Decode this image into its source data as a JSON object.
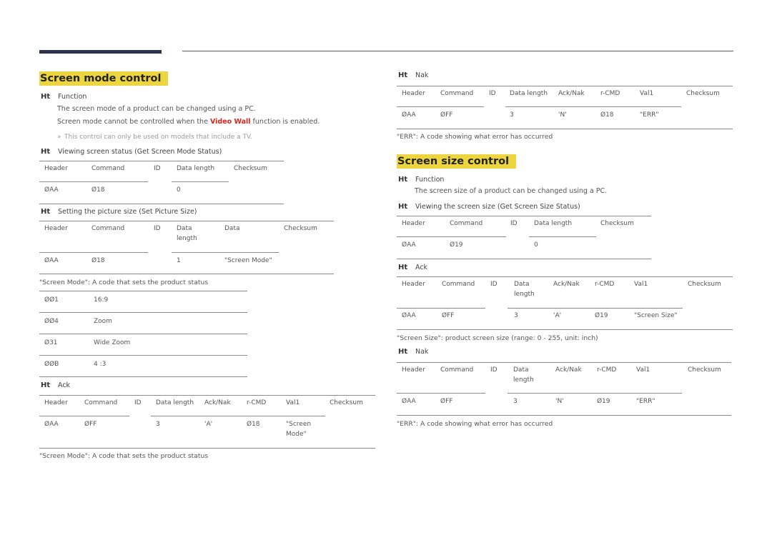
{
  "left": {
    "title": "Screen mode control",
    "function_label": "Function",
    "bullet_marker": "Ht",
    "desc1": "The screen mode of a product can be changed using a PC.",
    "desc2_pre": "Screen mode cannot be controlled when the ",
    "desc2_highlight": "Video Wall",
    "desc2_post": " function is enabled.",
    "note_marker": "»",
    "note": "This control can only be used on models that include a TV.",
    "view_status_label": "Viewing screen status (Get Screen Mode Status)",
    "view_table": {
      "headers": [
        "Header",
        "Command",
        "ID",
        "Data length",
        "Checksum"
      ],
      "row": [
        "ØAA",
        "Ø18",
        "",
        "0",
        ""
      ]
    },
    "set_label": "Setting the picture size (Set Picture Size)",
    "set_table": {
      "headers": [
        "Header",
        "Command",
        "ID",
        "Data length",
        "Data",
        "Checksum"
      ],
      "row": [
        "ØAA",
        "Ø18",
        "",
        "1",
        "\"Screen Mode\"",
        ""
      ]
    },
    "mode_caption": "\"Screen Mode\": A code that sets the product status",
    "mode_table": [
      {
        "code": "ØØ1",
        "label": "16:9"
      },
      {
        "code": "ØØ4",
        "label": "Zoom"
      },
      {
        "code": "Ø31",
        "label": "Wide Zoom"
      },
      {
        "code": "ØØB",
        "label": "4 :3"
      }
    ],
    "ack_label": "Ack",
    "ack_table": {
      "headers": [
        "Header",
        "Command",
        "ID",
        "Data length",
        "Ack/Nak",
        "r-CMD",
        "Val1",
        "Checksum"
      ],
      "row": [
        "ØAA",
        "ØFF",
        "",
        "3",
        "'A'",
        "Ø18",
        "\"Screen Mode\"",
        ""
      ]
    },
    "ack_caption": "\"Screen Mode\": A code that sets the product status"
  },
  "right": {
    "nak_label": "Nak",
    "nak_table": {
      "headers": [
        "Header",
        "Command",
        "ID",
        "Data length",
        "Ack/Nak",
        "r-CMD",
        "Val1",
        "Checksum"
      ],
      "row": [
        "ØAA",
        "ØFF",
        "",
        "3",
        "'N'",
        "Ø18",
        "\"ERR\"",
        ""
      ]
    },
    "nak_caption": "\"ERR\": A code showing what error has occurred",
    "title": "Screen size control",
    "function_label": "Function",
    "desc1": "The screen size of a product can be changed using a PC.",
    "view_label": "Viewing the screen size (Get Screen Size Status)",
    "view_table": {
      "headers": [
        "Header",
        "Command",
        "ID",
        "Data length",
        "Checksum"
      ],
      "row": [
        "ØAA",
        "Ø19",
        "",
        "0",
        ""
      ]
    },
    "ack_label": "Ack",
    "ack_table": {
      "headers": [
        "Header",
        "Command",
        "ID",
        "Data length",
        "Ack/Nak",
        "r-CMD",
        "Val1",
        "Checksum"
      ],
      "row": [
        "ØAA",
        "ØFF",
        "",
        "3",
        "'A'",
        "Ø19",
        "\"Screen Size\"",
        ""
      ]
    },
    "ack_caption": "\"Screen Size\": product screen size (range: 0 - 255, unit: inch)",
    "nak2_label": "Nak",
    "nak2_table": {
      "headers": [
        "Header",
        "Command",
        "ID",
        "Data length",
        "Ack/Nak",
        "r-CMD",
        "Val1",
        "Checksum"
      ],
      "row": [
        "ØAA",
        "ØFF",
        "",
        "3",
        "'N'",
        "Ø19",
        "\"ERR\"",
        ""
      ]
    },
    "nak2_caption": "\"ERR\": A code showing what error has occurred"
  }
}
